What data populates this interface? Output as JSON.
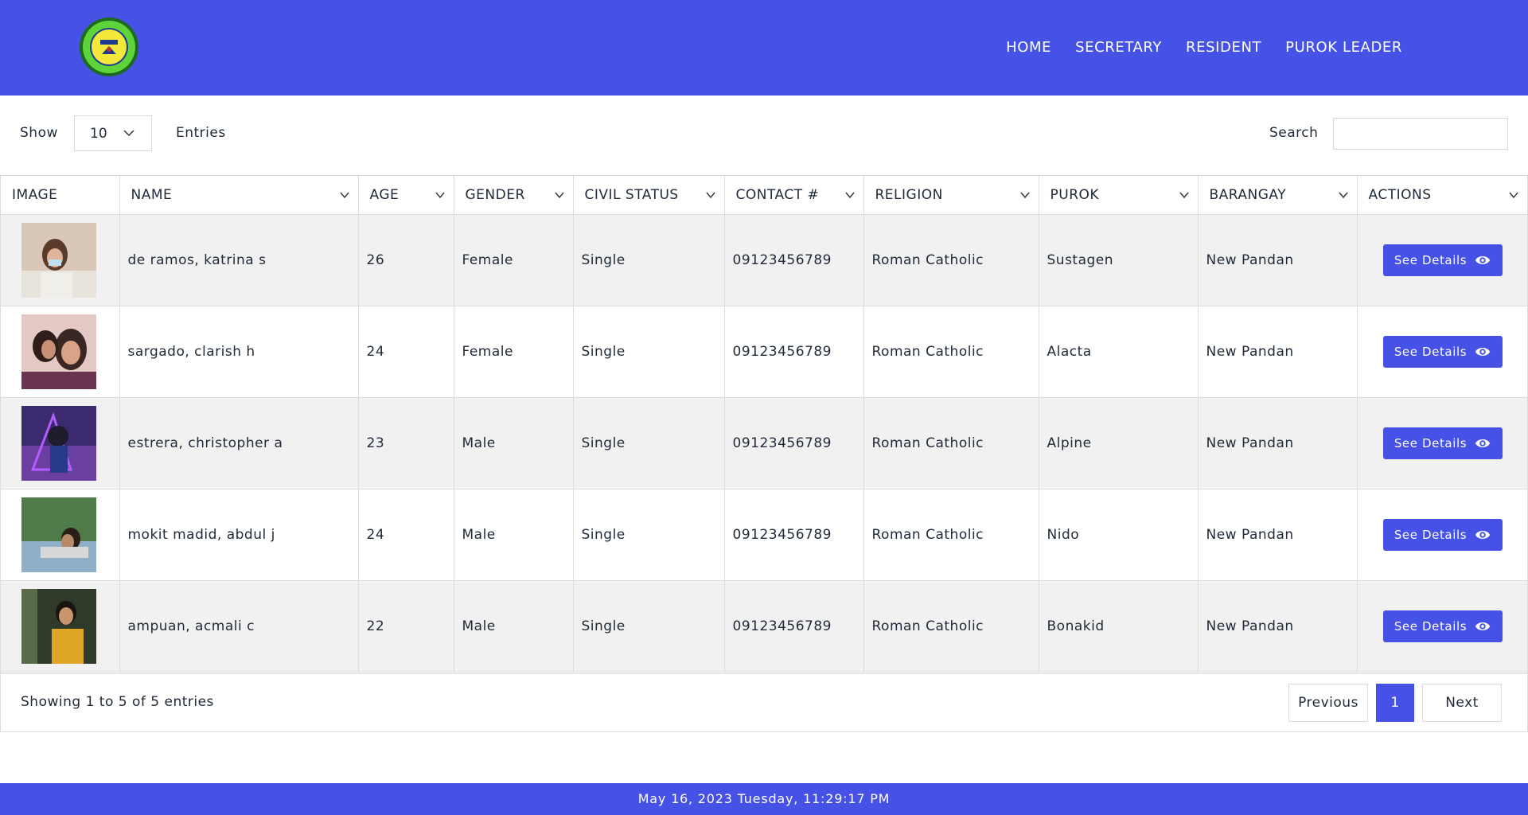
{
  "nav": [
    "HOME",
    "SECRETARY",
    "RESIDENT",
    "PUROK LEADER"
  ],
  "controls": {
    "show_label": "Show",
    "entries_value": "10",
    "entries_label": "Entries",
    "search_label": "Search",
    "search_value": ""
  },
  "table": {
    "columns": [
      "IMAGE",
      "NAME",
      "AGE",
      "GENDER",
      "CIVIL STATUS",
      "CONTACT #",
      "RELIGION",
      "PUROK",
      "BARANGAY",
      "ACTIONS"
    ],
    "rows": [
      {
        "name": "de ramos, katrina s",
        "age": "26",
        "gender": "Female",
        "civil_status": "Single",
        "contact": "09123456789",
        "religion": "Roman Catholic",
        "purok": "Sustagen",
        "barangay": "New Pandan",
        "action": "See Details"
      },
      {
        "name": "sargado, clarish h",
        "age": "24",
        "gender": "Female",
        "civil_status": "Single",
        "contact": "09123456789",
        "religion": "Roman Catholic",
        "purok": "Alacta",
        "barangay": "New Pandan",
        "action": "See Details"
      },
      {
        "name": "estrera, christopher a",
        "age": "23",
        "gender": "Male",
        "civil_status": "Single",
        "contact": "09123456789",
        "religion": "Roman Catholic",
        "purok": "Alpine",
        "barangay": "New Pandan",
        "action": "See Details"
      },
      {
        "name": "mokit madid, abdul j",
        "age": "24",
        "gender": "Male",
        "civil_status": "Single",
        "contact": "09123456789",
        "religion": "Roman Catholic",
        "purok": "Nido",
        "barangay": "New Pandan",
        "action": "See Details"
      },
      {
        "name": "ampuan, acmali c",
        "age": "22",
        "gender": "Male",
        "civil_status": "Single",
        "contact": "09123456789",
        "religion": "Roman Catholic",
        "purok": "Bonakid",
        "barangay": "New Pandan",
        "action": "See Details"
      }
    ]
  },
  "pagination": {
    "summary": "Showing 1 to 5 of 5 entries",
    "previous": "Previous",
    "current": "1",
    "next": "Next"
  },
  "footer": {
    "datetime": "May 16, 2023 Tuesday, 11:29:17 PM"
  },
  "colors": {
    "brand": "#4552e5",
    "row_alt": "#f1f1f1"
  },
  "icons": [
    "barangay-seal-logo",
    "chevron-down-icon",
    "eye-icon"
  ]
}
